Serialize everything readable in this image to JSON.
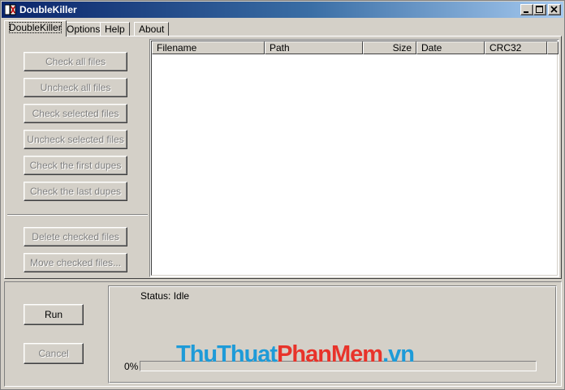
{
  "window": {
    "title": "DoubleKiller"
  },
  "tabs": [
    {
      "label": "DoubleKiller",
      "active": true
    },
    {
      "label": "Options"
    },
    {
      "label": "Help"
    },
    {
      "label": "About"
    }
  ],
  "side_buttons": {
    "check_all": "Check all files",
    "uncheck_all": "Uncheck all files",
    "check_selected": "Check selected files",
    "uncheck_selected": "Uncheck selected files",
    "check_first": "Check the first dupes",
    "check_last": "Check the last dupes",
    "delete_checked": "Delete checked files",
    "move_checked": "Move checked files..."
  },
  "columns": [
    "Filename",
    "Path",
    "Size",
    "Date",
    "CRC32"
  ],
  "rows": [],
  "actions": {
    "run": "Run",
    "cancel": "Cancel"
  },
  "status": {
    "text": "Status: Idle",
    "progress_label": "0%",
    "progress": 0
  },
  "watermark": {
    "part1": "ThuThuat",
    "part2": "PhanMem",
    "part3": ".vn"
  },
  "colors": {
    "title_start": "#0a246a",
    "title_end": "#a6caf0",
    "face": "#d4d0c8",
    "watermark_blue": "#1e9bd8",
    "watermark_red": "#e8332a"
  }
}
